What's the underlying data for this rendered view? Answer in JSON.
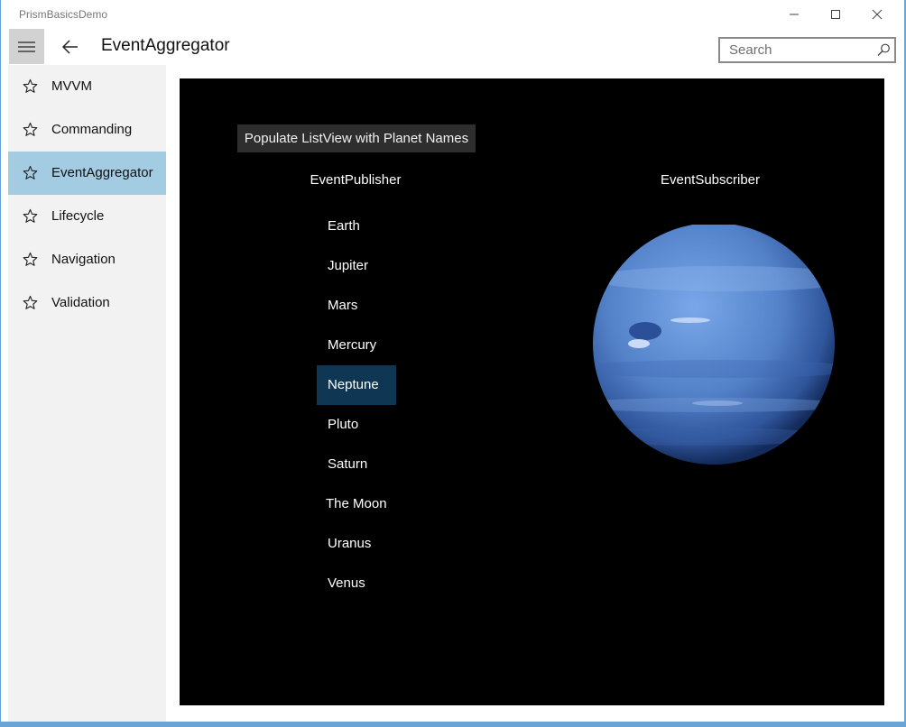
{
  "window": {
    "app_title": "PrismBasicsDemo",
    "controls": [
      "minimize-icon",
      "maximize-icon",
      "close-icon"
    ]
  },
  "header": {
    "page_title": "EventAggregator",
    "search_placeholder": "Search"
  },
  "sidebar": {
    "items": [
      {
        "label": "MVVM",
        "icon": "star-icon",
        "selected": false
      },
      {
        "label": "Commanding",
        "icon": "star-icon",
        "selected": false
      },
      {
        "label": "EventAggregator",
        "icon": "star-icon",
        "selected": true
      },
      {
        "label": "Lifecycle",
        "icon": "star-icon",
        "selected": false
      },
      {
        "label": "Navigation",
        "icon": "star-icon",
        "selected": false
      },
      {
        "label": "Validation",
        "icon": "star-icon",
        "selected": false
      }
    ]
  },
  "main": {
    "populate_button": "Populate ListView with Planet Names",
    "publisher_header": "EventPublisher",
    "subscriber_header": "EventSubscriber",
    "planets": [
      "Earth",
      "Jupiter",
      "Mars",
      "Mercury",
      "Neptune",
      "Pluto",
      "Saturn",
      "The Moon",
      "Uranus",
      "Venus"
    ],
    "selected_planet": "Neptune",
    "subscriber_image": "neptune-planet-image"
  },
  "colors": {
    "accent_selected_nav": "#a3cce3",
    "selected_list_item": "#0f3652",
    "content_background": "#000000",
    "sidebar_background": "#f2f2f2"
  }
}
